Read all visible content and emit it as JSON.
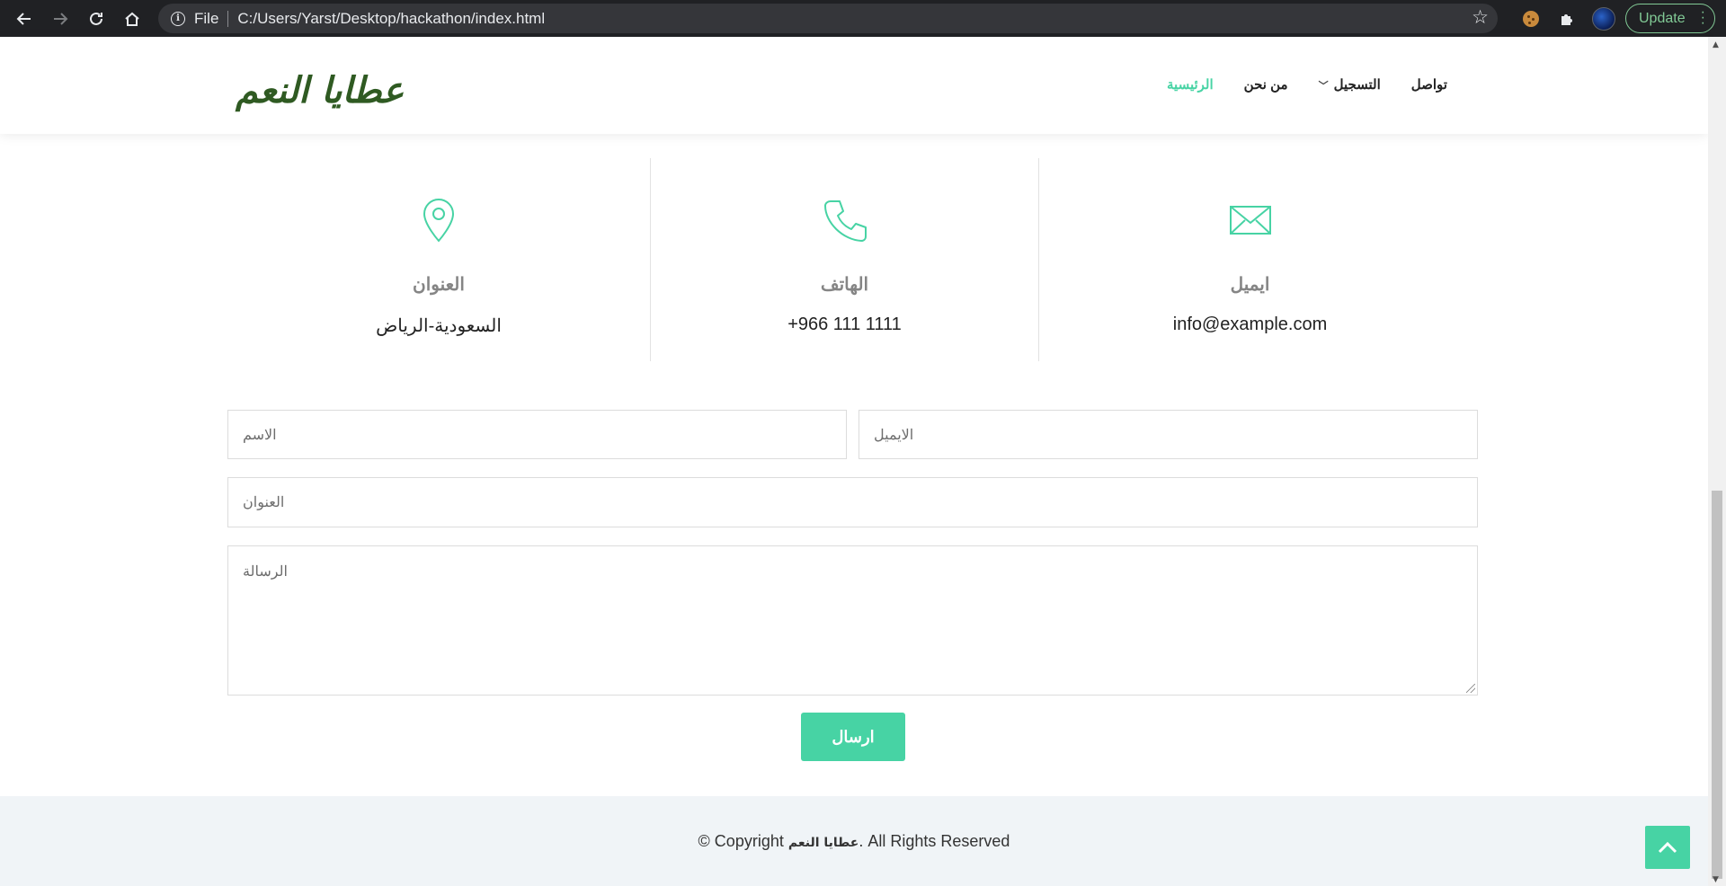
{
  "browser": {
    "back_icon": "arrow-left-icon",
    "forward_icon": "arrow-right-icon",
    "reload_icon": "reload-icon",
    "home_icon": "home-icon",
    "file_label": "File",
    "url": "C:/Users/Yarst/Desktop/hackathon/index.html",
    "update_label": "Update"
  },
  "header": {
    "logo_text": "عطايا النعم",
    "menu": [
      {
        "label": "الرئيسية",
        "active": true
      },
      {
        "label": "من نحن",
        "active": false
      },
      {
        "label": "التسجيل",
        "active": false,
        "has_dropdown": true
      },
      {
        "label": "تواصل",
        "active": false
      }
    ]
  },
  "contact_info": [
    {
      "icon": "location-pin-icon",
      "title": "العنوان",
      "value": "السعودية-الرياض"
    },
    {
      "icon": "phone-icon",
      "title": "الهاتف",
      "value": "+966 111 1111"
    },
    {
      "icon": "envelope-icon",
      "title": "ايميل",
      "value": "info@example.com"
    }
  ],
  "form": {
    "name_placeholder": "الاسم",
    "email_placeholder": "الايميل",
    "subject_placeholder": "العنوان",
    "message_placeholder": "الرسالة",
    "submit_label": "ارسال"
  },
  "footer": {
    "copyright_prefix": "© Copyright ",
    "brand": "عطايا النعم",
    "copyright_suffix": ". All Rights Reserved"
  },
  "colors": {
    "accent": "#47d3a4",
    "logo": "#2f5a22",
    "footer_bg": "#f0f4f7"
  }
}
